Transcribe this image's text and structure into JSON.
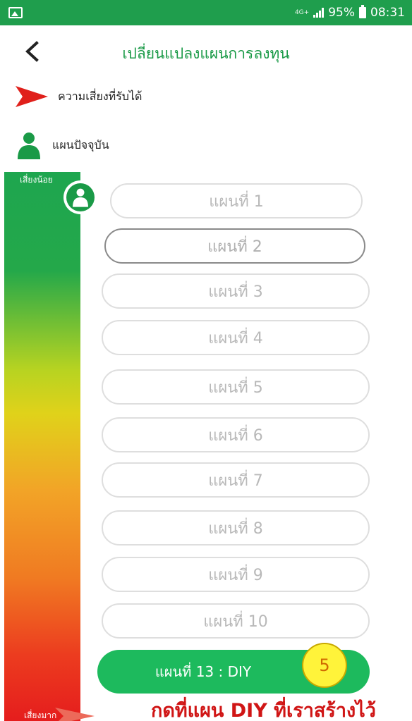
{
  "status_bar": {
    "network": "4G+",
    "battery": "95%",
    "time": "08:31"
  },
  "header": {
    "title": "เปลี่ยนแปลงแผนการลงทุน"
  },
  "legend": {
    "acceptable_risk": "ความเสี่ยงที่รับได้",
    "current_plan": "แผนปัจจุบัน"
  },
  "risk_scale": {
    "low": "เสี่ยงน้อย",
    "high": "เสี่ยงมาก"
  },
  "plans": [
    {
      "label": "แผนที่ 1"
    },
    {
      "label": "แผนที่ 2"
    },
    {
      "label": "แผนที่ 3"
    },
    {
      "label": "แผนที่ 4"
    },
    {
      "label": "แผนที่ 5"
    },
    {
      "label": "แผนที่ 6"
    },
    {
      "label": "แผนที่ 7"
    },
    {
      "label": "แผนที่ 8"
    },
    {
      "label": "แผนที่ 9"
    },
    {
      "label": "แผนที่ 10"
    }
  ],
  "diy_plan": {
    "label": "แผนที่ 13 : DIY"
  },
  "step_badge": "5",
  "instruction": "กดที่แผน DIY ที่เราสร้างไว้",
  "colors": {
    "brand_green": "#1a9a47",
    "diy_green": "#1dba5d",
    "instruction_red": "#d01515",
    "badge_yellow": "#fff33a"
  }
}
